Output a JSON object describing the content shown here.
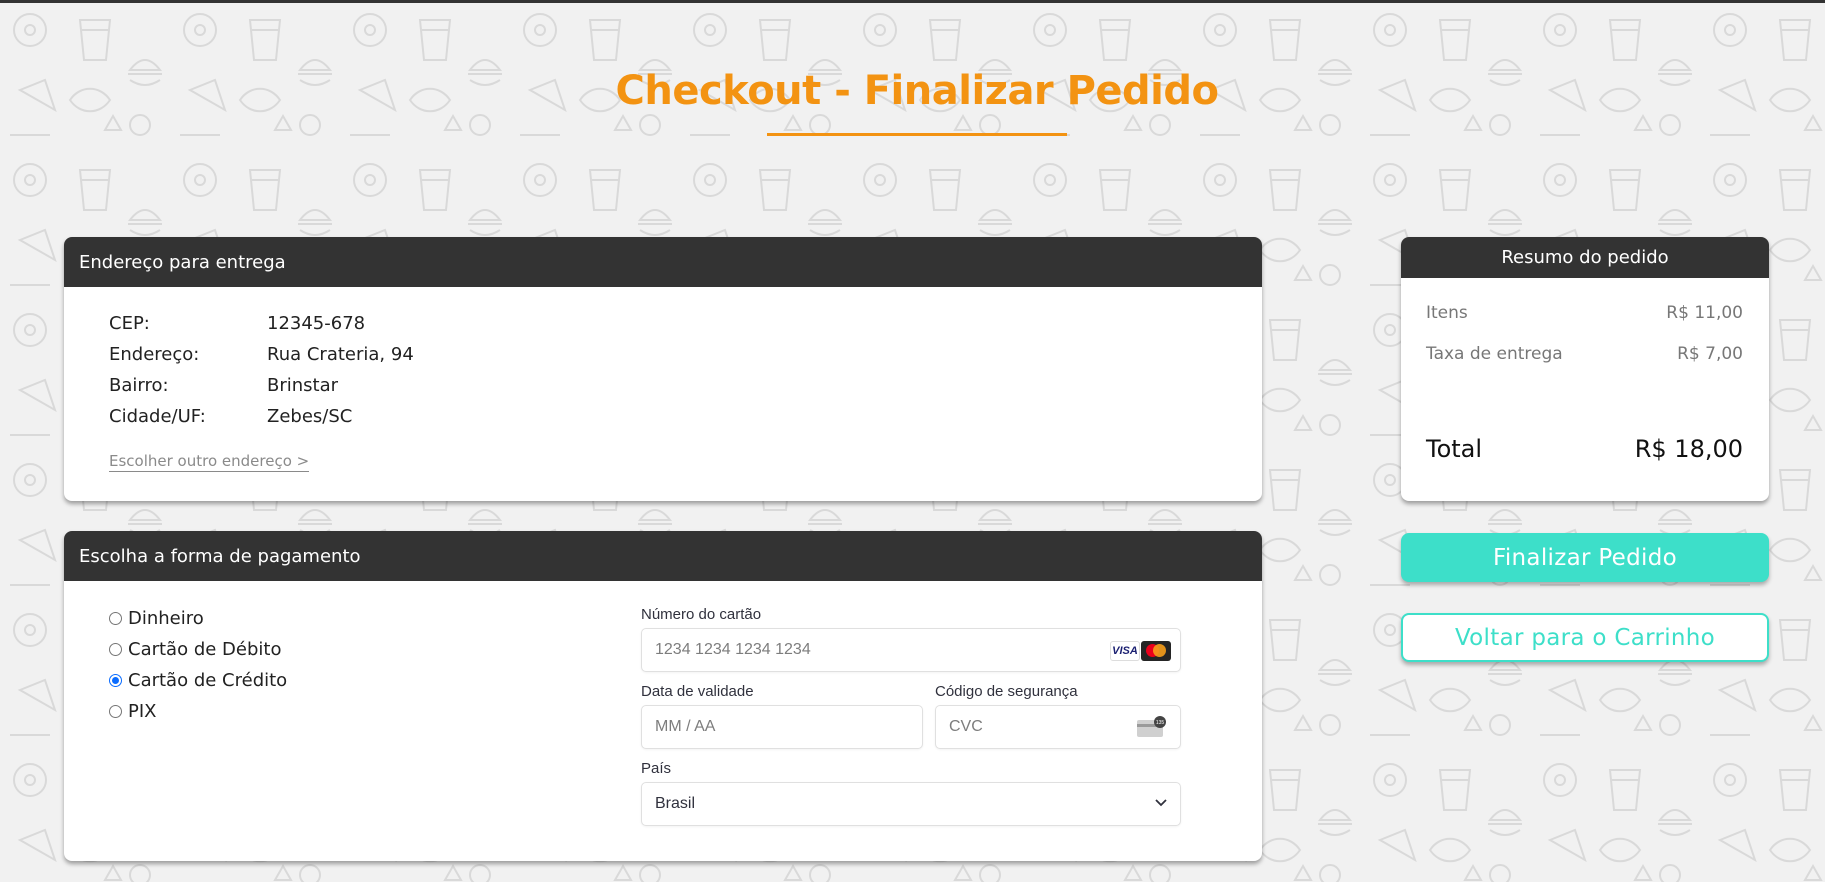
{
  "page": {
    "title": "Checkout - Finalizar Pedido",
    "accent_color": "#f39312",
    "button_color": "#3ddfc9"
  },
  "address": {
    "header": "Endereço para entrega",
    "rows": [
      {
        "label": "CEP:",
        "value": "12345-678"
      },
      {
        "label": "Endereço:",
        "value": "Rua Crateria, 94"
      },
      {
        "label": "Bairro:",
        "value": "Brinstar"
      },
      {
        "label": "Cidade/UF:",
        "value": "Zebes/SC"
      }
    ],
    "change_link": "Escolher outro endereço >"
  },
  "payment": {
    "header": "Escolha a forma de pagamento",
    "options": [
      {
        "label": "Dinheiro",
        "checked": false
      },
      {
        "label": "Cartão de Débito",
        "checked": false
      },
      {
        "label": "Cartão de Crédito",
        "checked": true
      },
      {
        "label": "PIX",
        "checked": false
      }
    ],
    "card_form": {
      "number_label": "Número do cartão",
      "number_placeholder": "1234 1234 1234 1234",
      "card_brands": [
        "visa-icon",
        "mastercard-icon"
      ],
      "visa_text": "VISA",
      "expiry_label": "Data de validade",
      "expiry_placeholder": "MM / AA",
      "cvc_label": "Código de segurança",
      "cvc_placeholder": "CVC",
      "cvc_icon_text": "135",
      "country_label": "País",
      "country_value": "Brasil"
    }
  },
  "summary": {
    "header": "Resumo do pedido",
    "items_label": "Itens",
    "items_value": "R$ 11,00",
    "fee_label": "Taxa de entrega",
    "fee_value": "R$ 7,00",
    "total_label": "Total",
    "total_value": "R$ 18,00"
  },
  "actions": {
    "finish_label": "Finalizar Pedido",
    "back_label": "Voltar para o Carrinho"
  }
}
